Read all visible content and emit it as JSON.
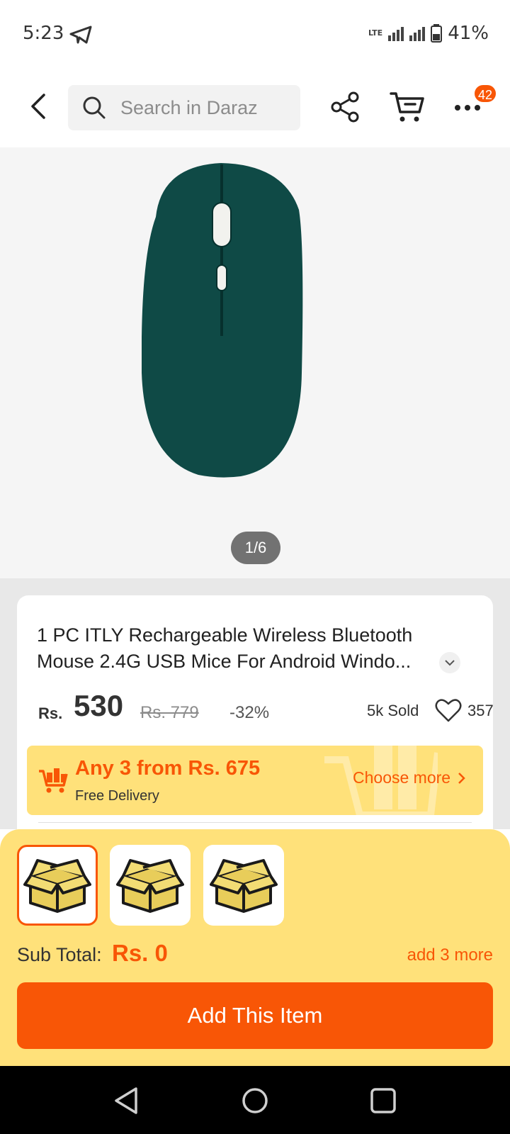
{
  "status_bar": {
    "time": "5:23",
    "network": "LTE",
    "battery": "41%"
  },
  "header": {
    "search_placeholder": "Search in Daraz",
    "cart_badge": "42"
  },
  "gallery": {
    "counter": "1/6",
    "product_color": "#0f4a46"
  },
  "product": {
    "title": "1 PC ITLY Rechargeable Wireless Bluetooth Mouse 2.4G USB Mice For Android Windo...",
    "currency": "Rs.",
    "price": "530",
    "original_price": "Rs. 779",
    "discount": "-32%",
    "sold": "5k Sold",
    "likes": "357"
  },
  "promo": {
    "title": "Any 3 from Rs. 675",
    "subtitle": "Free Delivery",
    "link": "Choose more"
  },
  "bundle_sheet": {
    "slots": [
      {
        "icon": "box-icon",
        "selected": true
      },
      {
        "icon": "box-icon",
        "selected": false
      },
      {
        "icon": "box-icon",
        "selected": false
      }
    ],
    "subtotal_label": "Sub Total:",
    "subtotal_value": "Rs. 0",
    "add_more": "add 3 more",
    "button": "Add This Item"
  },
  "colors": {
    "accent": "#f85606",
    "promo_bg": "#ffe17a"
  }
}
